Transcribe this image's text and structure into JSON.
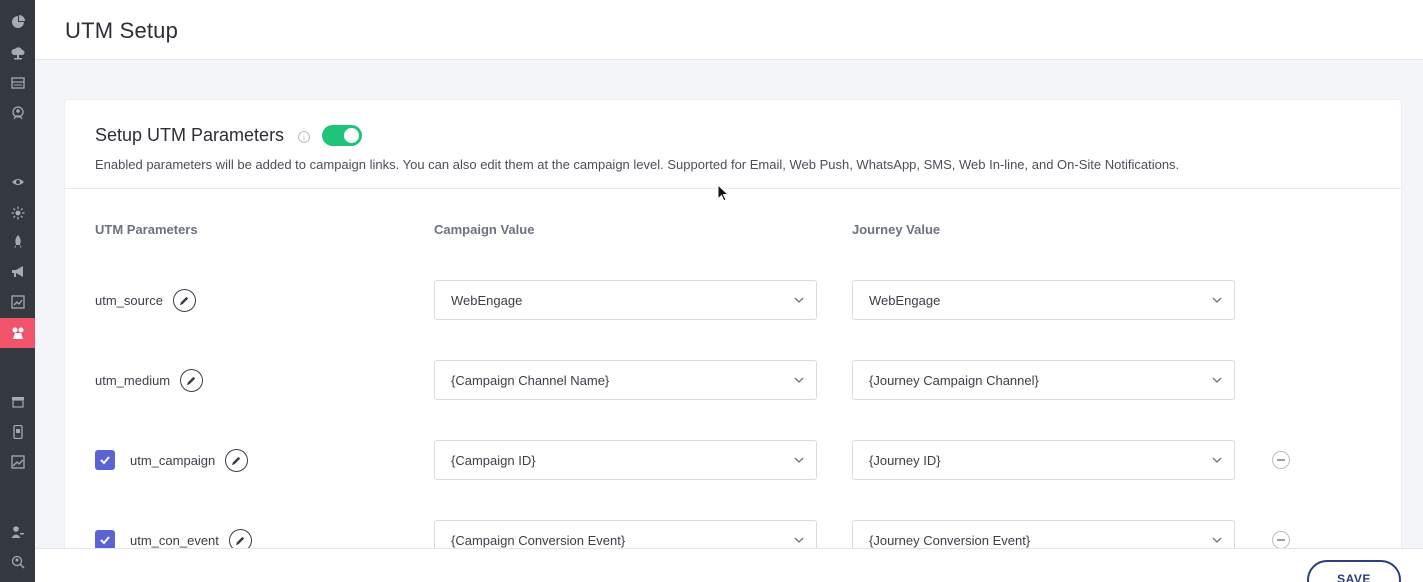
{
  "header": {
    "title": "UTM Setup"
  },
  "sidebar": {
    "icons": [
      "pie-chart-icon",
      "cloud-upload-icon",
      "database-icon",
      "badge-icon",
      "eye-icon",
      "sun-icon",
      "rocket-icon",
      "megaphone-icon",
      "report-icon",
      "integrations-icon",
      "store-icon",
      "mobile-icon",
      "image-icon",
      "user-settings-icon",
      "search-users-icon"
    ],
    "active": "integrations-icon"
  },
  "card": {
    "title": "Setup UTM Parameters",
    "info": "i",
    "toggle_on": true,
    "description": "Enabled parameters will be added to campaign links. You can also edit them at the campaign level. Supported for Email, Web Push, WhatsApp, SMS, Web In-line, and On-Site Notifications."
  },
  "columns": {
    "param": "UTM Parameters",
    "campaign": "Campaign Value",
    "journey": "Journey Value"
  },
  "rows": [
    {
      "name": "utm_source",
      "checkbox": false,
      "removable": false,
      "campaign_value": "WebEngage",
      "journey_value": "WebEngage"
    },
    {
      "name": "utm_medium",
      "checkbox": false,
      "removable": false,
      "campaign_value": "{Campaign Channel Name}",
      "journey_value": "{Journey Campaign Channel}"
    },
    {
      "name": "utm_campaign",
      "checkbox": true,
      "removable": true,
      "campaign_value": "{Campaign ID}",
      "journey_value": "{Journey ID}"
    },
    {
      "name": "utm_con_event",
      "checkbox": true,
      "removable": true,
      "campaign_value": "{Campaign Conversion Event}",
      "journey_value": "{Journey Conversion Event}"
    }
  ],
  "footer": {
    "save_label": "SAVE"
  },
  "colors": {
    "toggle": "#1ec47a",
    "checkbox": "#5b63d3",
    "sidebar": "#34383f",
    "active_nav": "#f0546a",
    "save": "#2c3e7d"
  }
}
